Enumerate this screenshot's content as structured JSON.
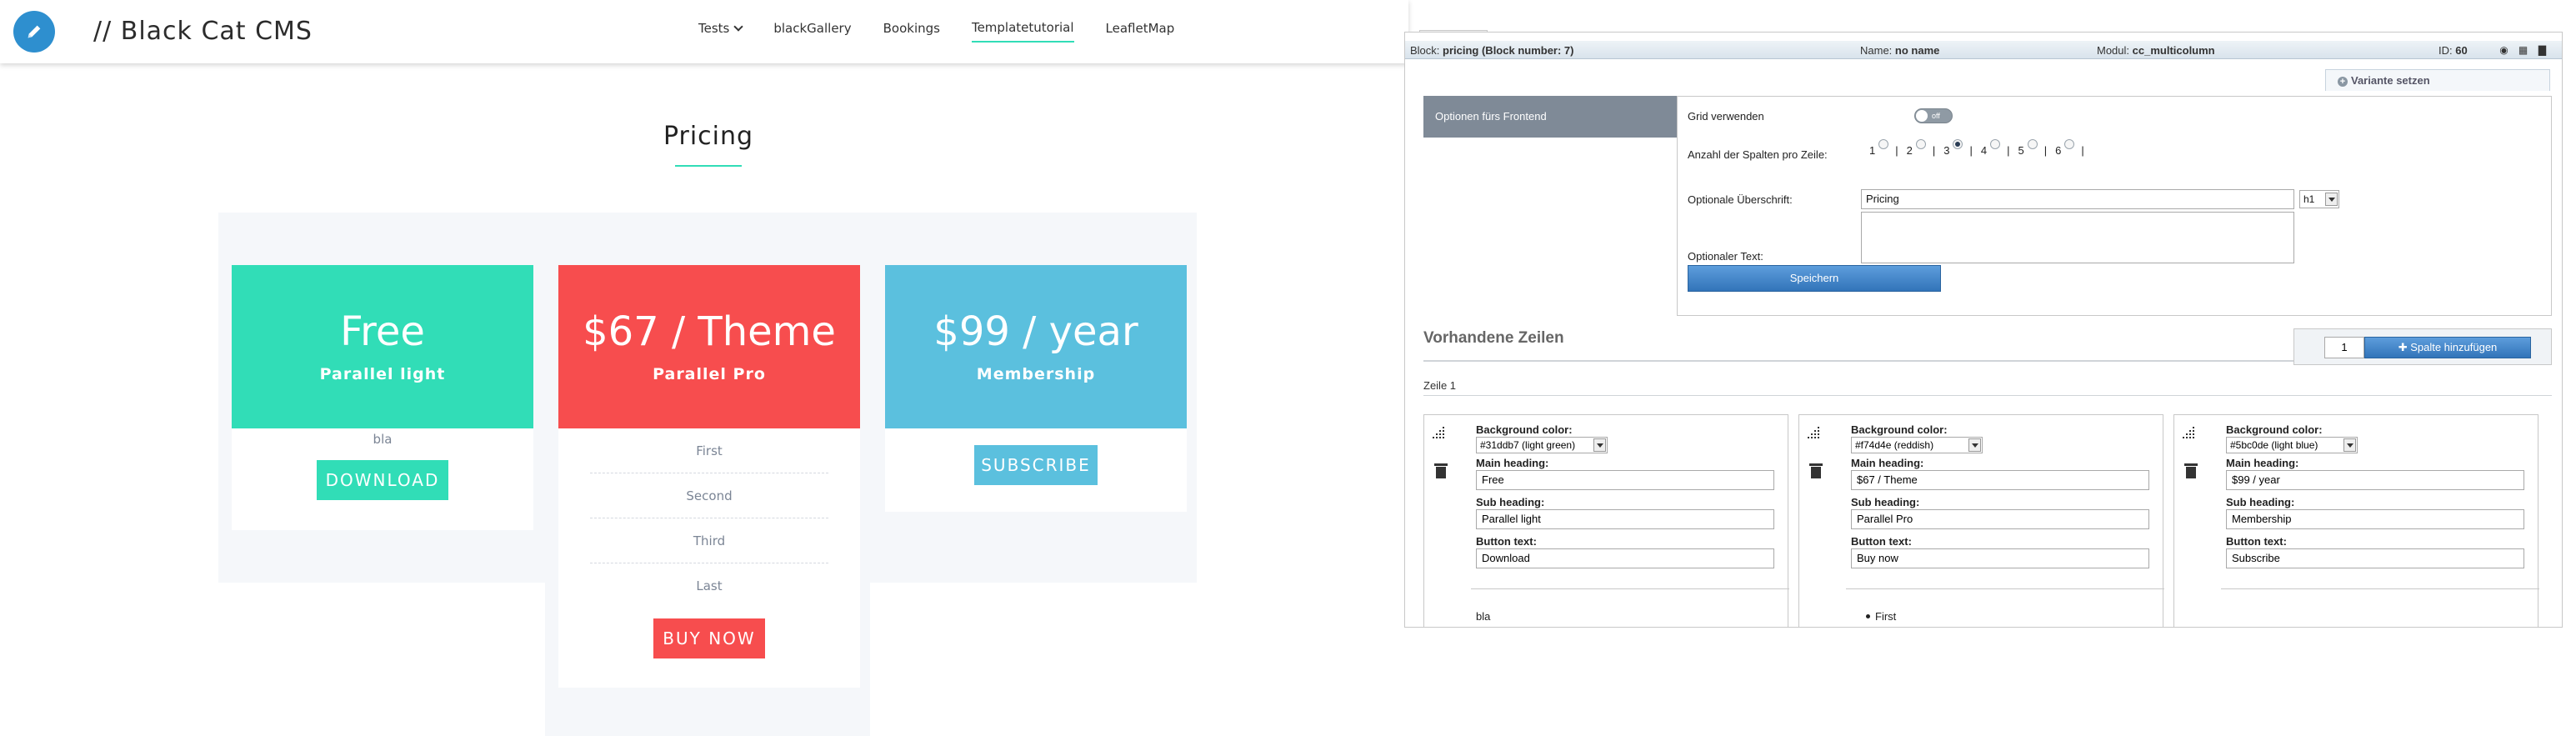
{
  "site": {
    "title": "// Black Cat CMS",
    "nav": [
      "Tests",
      "blackGallery",
      "Bookings",
      "Templatetutorial",
      "LeafletMap"
    ],
    "active_nav": "Templatetutorial",
    "section_title": "Pricing",
    "cards": [
      {
        "price": "Free",
        "subtitle": "Parallel light",
        "color": "#31ddb7",
        "text": "bla",
        "button": "DOWNLOAD"
      },
      {
        "price": "$67 / Theme",
        "subtitle": "Parallel Pro",
        "color": "#f74d4e",
        "features": [
          "First",
          "Second",
          "Third",
          "Last"
        ],
        "button": "BUY NOW"
      },
      {
        "price": "$99 / year",
        "subtitle": "Membership",
        "color": "#5bc0de",
        "button": "SUBSCRIBE"
      }
    ]
  },
  "cms": {
    "block_bar": {
      "block_label": "Block:",
      "block_value": "pricing (Block number: 7)",
      "name_label": "Name:",
      "name_value": "no name",
      "module_label": "Modul:",
      "module_value": "cc_multicolumn",
      "id_label": "ID:",
      "id_value": "60"
    },
    "variant_button": "Variante setzen",
    "options_tab": "Optionen fürs Frontend",
    "grid_label": "Grid verwenden",
    "toggle_state": "off",
    "columns_label": "Anzahl der Spalten pro Zeile:",
    "column_options": [
      "1",
      "2",
      "3",
      "4",
      "5",
      "6"
    ],
    "columns_selected": "3",
    "heading_label": "Optionale Überschrift:",
    "heading_value": "Pricing",
    "heading_level": "h1",
    "text_label": "Optionaler Text:",
    "save_button": "Speichern",
    "existing_rows_title": "Vorhandene Zeilen",
    "add_count": "1",
    "add_button": "Spalte hinzufügen",
    "row_label": "Zeile 1",
    "columns": [
      {
        "bg_label": "Background color:",
        "bg_value": "#31ddb7 (light green)",
        "main_label": "Main heading:",
        "main_value": "Free",
        "sub_label": "Sub heading:",
        "sub_value": "Parallel light",
        "btn_label": "Button text:",
        "btn_value": "Download",
        "content": "bla"
      },
      {
        "bg_label": "Background color:",
        "bg_value": "#f74d4e (reddish)",
        "main_label": "Main heading:",
        "main_value": "$67 / Theme",
        "sub_label": "Sub heading:",
        "sub_value": "Parallel Pro",
        "btn_label": "Button text:",
        "btn_value": "Buy now",
        "content": "First"
      },
      {
        "bg_label": "Background color:",
        "bg_value": "#5bc0de (light blue)",
        "main_label": "Main heading:",
        "main_value": "$99 / year",
        "sub_label": "Sub heading:",
        "sub_value": "Membership",
        "btn_label": "Button text:",
        "btn_value": "Subscribe",
        "content": ""
      }
    ]
  }
}
